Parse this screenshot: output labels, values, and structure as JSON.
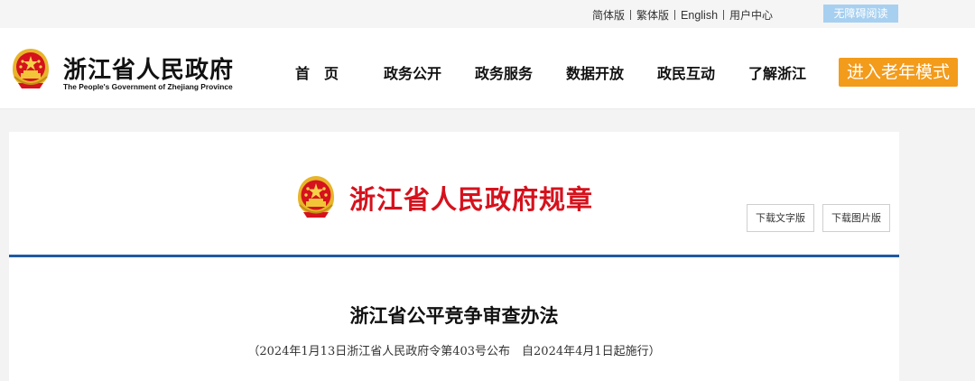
{
  "topbar": {
    "simplified": "简体版",
    "traditional": "繁体版",
    "english": "English",
    "user_center": "用户中心",
    "accessibility": "无障碍阅读"
  },
  "header": {
    "site_name": "浙江省人民政府",
    "site_name_en": "The People's Government of Zhejiang Province",
    "nav": [
      "首　页",
      "政务公开",
      "政务服务",
      "数据开放",
      "政民互动",
      "了解浙江"
    ],
    "elder_mode": "进入老年模式"
  },
  "page": {
    "section_title": "浙江省人民政府规章",
    "download_text": "下载文字版",
    "download_image": "下载图片版",
    "doc_title": "浙江省公平竞争审查办法",
    "doc_subtitle": "（2024年1月13日浙江省人民政府令第403号公布　自2024年4月1日起施行）"
  },
  "colors": {
    "accent_red": "#d5121d",
    "nav_divider_blue": "#1f5aa3",
    "elder_orange": "#f39b1b",
    "a11y_blue": "#a7d0f0"
  },
  "icons": {
    "logo": "national-emblem-icon",
    "section": "national-emblem-icon"
  }
}
